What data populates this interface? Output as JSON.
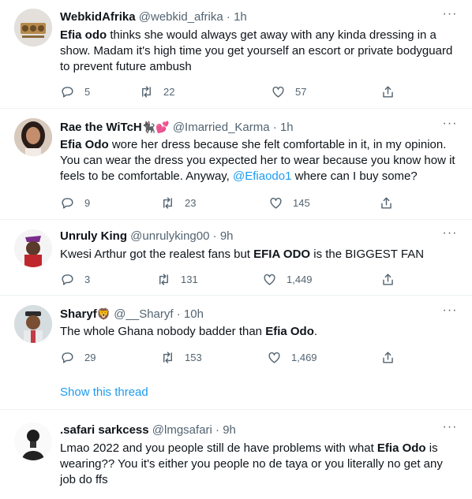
{
  "tweets": [
    {
      "name": "WebkidAfrika",
      "emoji": "",
      "handle": "@webkid_afrika",
      "time": "1h",
      "text_parts": [
        {
          "b": "Efia odo"
        },
        {
          "t": " thinks she would always get away with any kinda dressing in a show. Madam it's high time you get yourself an escort or private bodyguard to prevent future ambush"
        }
      ],
      "replies": "5",
      "retweets": "22",
      "likes": "57"
    },
    {
      "name": "Rae the WiTcH",
      "emoji": "🐈‍⬛💕",
      "handle": "@Imarried_Karma",
      "time": "1h",
      "text_parts": [
        {
          "b": "Efia Odo"
        },
        {
          "t": " wore her dress because she felt comfortable in it, in my opinion. You can wear the dress you expected her to wear because you know how it feels to be comfortable. Anyway, "
        },
        {
          "m": "@Efiaodo1"
        },
        {
          "t": " where can I buy some?"
        }
      ],
      "replies": "9",
      "retweets": "23",
      "likes": "145"
    },
    {
      "name": "Unruly King",
      "emoji": "",
      "handle": "@unrulyking00",
      "time": "9h",
      "text_parts": [
        {
          "t": "Kwesi Arthur got the realest fans but "
        },
        {
          "b": "EFIA ODO"
        },
        {
          "t": " is the BIGGEST FAN"
        }
      ],
      "replies": "3",
      "retweets": "131",
      "likes": "1,449"
    },
    {
      "name": "Sharyf",
      "emoji": "🦁",
      "handle": "@__Sharyf",
      "time": "10h",
      "text_parts": [
        {
          "t": "The whole Ghana nobody badder than "
        },
        {
          "b": "Efia Odo"
        },
        {
          "t": "."
        }
      ],
      "replies": "29",
      "retweets": "153",
      "likes": "1,469"
    },
    {
      "name": ".safari sarkcess",
      "emoji": "",
      "handle": "@lmgsafari",
      "time": "9h",
      "text_parts": [
        {
          "t": "Lmao 2022 and you people still de have problems with what "
        },
        {
          "b": "Efia Odo"
        },
        {
          "t": " is wearing?? You it's either you people no de taya or you literally no get any job do ffs"
        }
      ]
    }
  ],
  "show_thread": "Show this thread",
  "sep": "·",
  "more_glyph": "···",
  "colors": {
    "accent": "#1d9bf0",
    "meta": "#536471",
    "divider": "#eff3f4"
  }
}
